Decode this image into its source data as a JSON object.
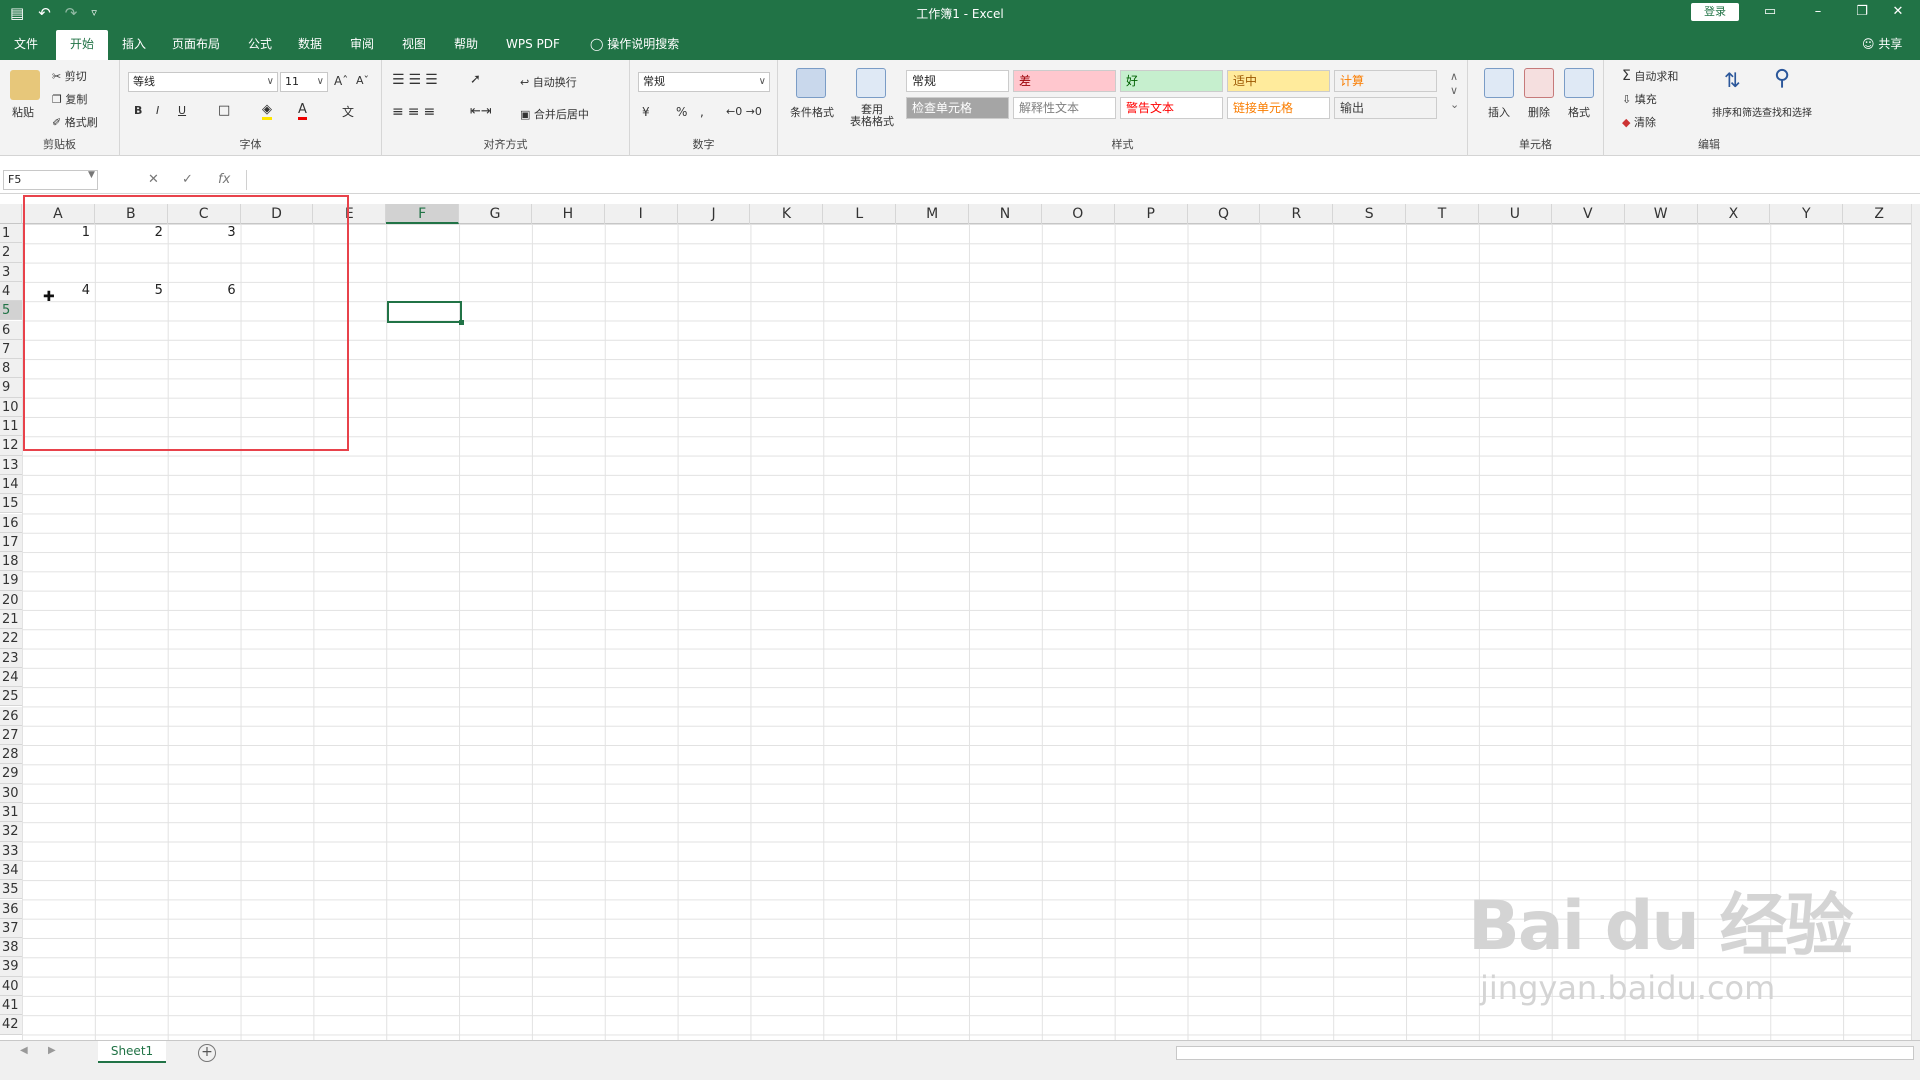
{
  "window": {
    "title": "工作簿1 - Excel",
    "login_label": "登录",
    "qat": [
      "save-icon",
      "undo-icon",
      "redo-icon",
      "customize-icon"
    ]
  },
  "tabs": [
    "文件",
    "开始",
    "插入",
    "页面布局",
    "公式",
    "数据",
    "审阅",
    "视图",
    "帮助",
    "WPS PDF",
    "操作说明搜索"
  ],
  "active_tab": "开始",
  "share_label": "共享",
  "ribbon": {
    "clipboard": {
      "paste": "粘贴",
      "cut": "剪切",
      "copy": "复制",
      "format_painter": "格式刷",
      "label": "剪贴板"
    },
    "font": {
      "name": "等线",
      "size": "11",
      "bold": "B",
      "italic": "I",
      "underline": "U",
      "label": "字体"
    },
    "alignment": {
      "wrap": "自动换行",
      "merge": "合并后居中",
      "label": "对齐方式"
    },
    "number": {
      "format": "常规",
      "percent": "%",
      "comma": ",",
      "label": "数字"
    },
    "styles": {
      "conditional": "条件格式",
      "table": "套用\n表格格式",
      "cells": [
        {
          "text": "常规",
          "bg": "#ffffff",
          "color": "#222222"
        },
        {
          "text": "差",
          "bg": "#ffc7ce",
          "color": "#9c0006"
        },
        {
          "text": "好",
          "bg": "#c6efce",
          "color": "#006100"
        },
        {
          "text": "适中",
          "bg": "#ffeb9c",
          "color": "#9c5700"
        },
        {
          "text": "计算",
          "bg": "#f2f2f2",
          "color": "#fa7d00"
        },
        {
          "text": "检查单元格",
          "bg": "#a5a5a5",
          "color": "#ffffff"
        },
        {
          "text": "解释性文本",
          "bg": "#ffffff",
          "color": "#7f7f7f"
        },
        {
          "text": "警告文本",
          "bg": "#ffffff",
          "color": "#ff0000"
        },
        {
          "text": "链接单元格",
          "bg": "#ffffff",
          "color": "#fa7d00"
        },
        {
          "text": "输出",
          "bg": "#f2f2f2",
          "color": "#3f3f3f"
        }
      ],
      "label": "样式"
    },
    "cells_group": {
      "insert": "插入",
      "delete": "删除",
      "format": "格式",
      "label": "单元格"
    },
    "editing": {
      "autosum": "自动求和",
      "fill": "填充",
      "clear": "清除",
      "sort": "排序和筛选",
      "find": "查找和选择",
      "label": "编辑"
    }
  },
  "formula_bar": {
    "name_box": "F5",
    "fx": "fx",
    "value": ""
  },
  "columns": [
    "A",
    "B",
    "C",
    "D",
    "E",
    "F",
    "G",
    "H",
    "I",
    "J",
    "K",
    "L",
    "M",
    "N",
    "O",
    "P",
    "Q",
    "R",
    "S",
    "T",
    "U",
    "V",
    "W",
    "X",
    "Y",
    "Z"
  ],
  "selected_column": "F",
  "selected_row": 5,
  "row_count": 42,
  "cells": [
    {
      "ref": "A1",
      "value": "1"
    },
    {
      "ref": "B1",
      "value": "2"
    },
    {
      "ref": "C1",
      "value": "3"
    },
    {
      "ref": "A4",
      "value": "4"
    },
    {
      "ref": "B4",
      "value": "5"
    },
    {
      "ref": "C4",
      "value": "6"
    }
  ],
  "sheets": [
    "Sheet1"
  ],
  "watermark": {
    "brand": "Bai du 经验",
    "url": "jingyan.baidu.com"
  }
}
